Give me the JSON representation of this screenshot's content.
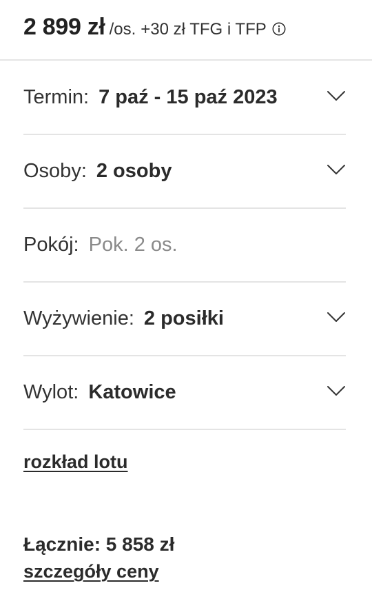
{
  "price": {
    "amount": "2 899 zł",
    "per": "/os.",
    "extra": "+30 zł TFG i TFP",
    "info_icon": "info-circle-icon"
  },
  "options": [
    {
      "label": "Termin:",
      "value": "7 paź - 15 paź 2023",
      "has_dropdown": true
    },
    {
      "label": "Osoby:",
      "value": "2 osoby",
      "has_dropdown": true
    },
    {
      "label": "Pokój:",
      "value": "Pok. 2 os.",
      "has_dropdown": false
    },
    {
      "label": "Wyżywienie:",
      "value": "2 posiłki",
      "has_dropdown": true
    },
    {
      "label": "Wylot:",
      "value": "Katowice",
      "has_dropdown": true
    }
  ],
  "flight_schedule_link": "rozkład lotu",
  "total": {
    "text": "Łącznie: 5 858 zł"
  },
  "price_details_link": "szczegóły ceny",
  "colors": {
    "text": "#2b2b2b",
    "muted": "#8a8a8a",
    "divider": "#e4e4e4"
  }
}
